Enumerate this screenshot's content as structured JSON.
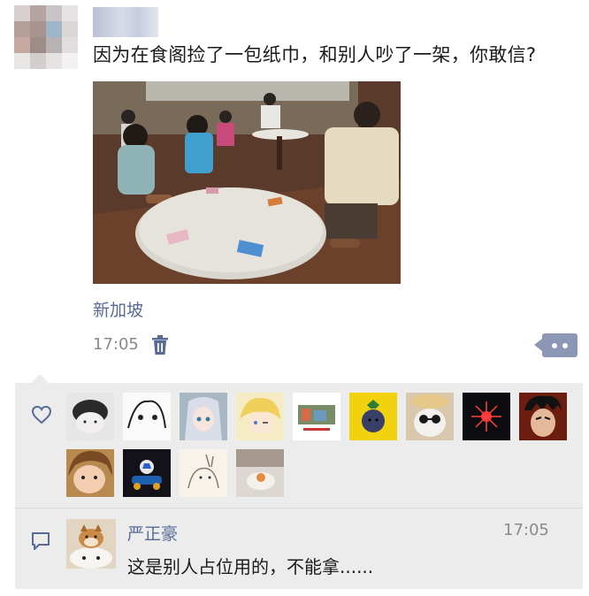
{
  "post": {
    "author_name": "",
    "text": "因为在食阁捡了一包纸巾，和别人吵了一架，你敢信?",
    "photo_icon": "hawker-centre-photo",
    "location": "新加坡",
    "time": "17:05",
    "delete_icon": "trash-icon",
    "more_icon": "more-dots-icon"
  },
  "likes": {
    "icon": "heart-icon",
    "count": 13
  },
  "comments": [
    {
      "name": "严正豪",
      "time": "17:05",
      "text": "这是别人占位用的，不能拿......",
      "icon": "comment-icon"
    }
  ],
  "colors": {
    "link": "#576b95",
    "panel_bg": "#ececec",
    "more_button": "#8b97b4",
    "muted_text": "#8a8a8a"
  }
}
